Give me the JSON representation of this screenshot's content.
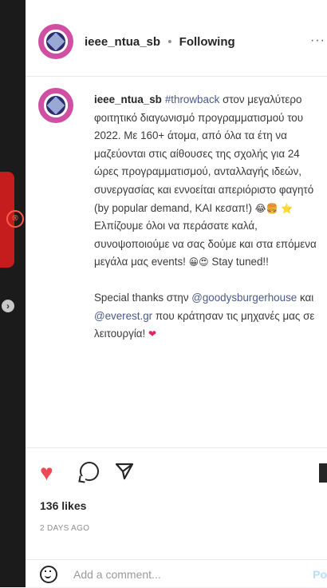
{
  "header": {
    "username": "ieee_ntua_sb",
    "separator": "•",
    "follow_status": "Following",
    "more": "···"
  },
  "caption": {
    "username": "ieee_ntua_sb",
    "hashtag": "#throwback",
    "text1": " στον μεγαλύτερο φοιτητικό διαγωνισμό προγραμματισμού του 2022. Με 160+ άτομα, από όλα τα έτη να μαζεύονται στις αίθουσες της σχολής για 24 ώρες προγραμματισμού, ανταλλαγής ιδεών, συνεργασίας και εννοείται απεριόριστο φαγητό (by popular demand, ΚΑΙ κεσαπ!)",
    "emoji1": "😂🍔",
    "emoji2": "⭐",
    "text2": "Ελπίζουμε όλοι να περάσατε καλά, συνοψοποιούμε να σας δούμε και στα επόμενα μεγάλα μας events!",
    "emoji3": "😀😍",
    "text3": "Stay tuned!!",
    "text4": "Special thanks στην",
    "mention1": "@goodysburgerhouse",
    "text5": " και",
    "mention2": "@everest.gr",
    "text6": " που κράτησαν τις μηχανές μας σε λειτουργία!",
    "emoji4": "❤"
  },
  "actions": {
    "like_icon": "heart-filled-icon",
    "comment_icon": "comment-icon",
    "share_icon": "send-icon",
    "save_icon": "bookmark-icon"
  },
  "likes": "136 likes",
  "timestamp": "2 DAYS AGO",
  "comment": {
    "placeholder": "Add a comment...",
    "post_label": "Po"
  },
  "colors": {
    "like": "#ed4956",
    "link": "#4a5a8a",
    "side_red": "#c51d1d"
  }
}
